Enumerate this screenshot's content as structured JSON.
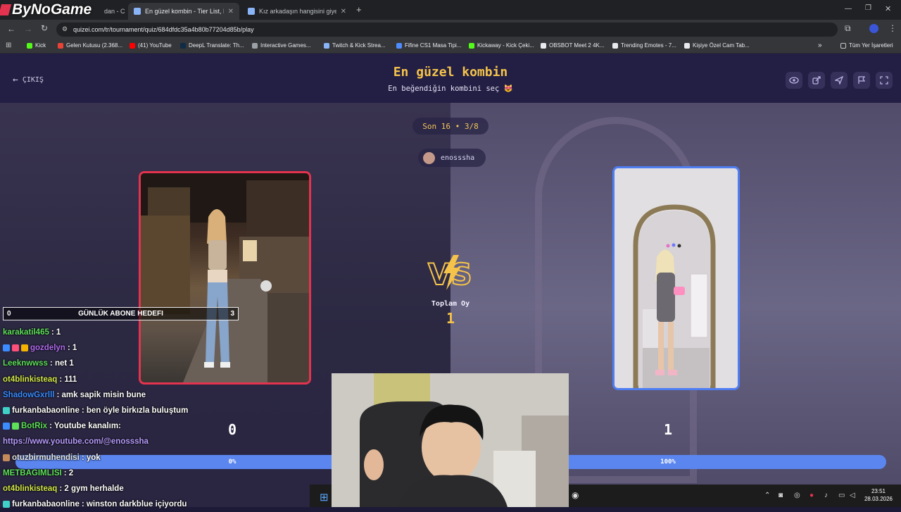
{
  "browser": {
    "tabs": [
      {
        "label": "dan - C"
      },
      {
        "label": "En güzel kombin - Tier List, Kö"
      },
      {
        "label": "Kız arkadaşın hangisini giyebili"
      }
    ],
    "new_tab": "+",
    "url": "quizei.com/tr/tournament/quiz/684dfdc35a4b80b77204d85b/play",
    "bookmarks": [
      {
        "label": "Kick"
      },
      {
        "label": "Gelen Kutusu (2.368..."
      },
      {
        "label": "(41) YouTube"
      },
      {
        "label": "DeepL Translate: Th..."
      },
      {
        "label": "Interactive Games..."
      },
      {
        "label": "Twitch & Kick Strea..."
      },
      {
        "label": "Fifine CS1 Masa Tipi..."
      },
      {
        "label": "Kickaway - Kick Çeki..."
      },
      {
        "label": "OBSBOT Meet 2 4K..."
      },
      {
        "label": "Trending Emotes - 7..."
      },
      {
        "label": "Kişiye Özel Cam Tab..."
      }
    ],
    "all_bookmarks": "Tüm Yer İşaretleri",
    "chevron": "»"
  },
  "overlay": {
    "logo": "ByNoGame",
    "goal": {
      "left": "0",
      "label": "GÜNLÜK ABONE HEDEFI",
      "right": "3"
    },
    "chat": [
      {
        "user": "karakatil465",
        "text": ": 1",
        "color": "#5ee05a",
        "badges": []
      },
      {
        "user": "gozdelyn",
        "text": ": 1",
        "color": "#b06cf0",
        "badges": [
          "#3a8cff",
          "#ff4f7a",
          "#f5b300"
        ]
      },
      {
        "user": "Leeknwwss",
        "text": ": net 1",
        "color": "#5ee05a",
        "badges": []
      },
      {
        "user": "ot4blinkisteaq",
        "text": ": 111",
        "color": "#d4e84a",
        "badges": []
      },
      {
        "user": "ShadowGxrlll",
        "text": ": amk sapik misin bune",
        "color": "#3a8cff",
        "badges": []
      },
      {
        "user": "furkanbabaonline",
        "text": ": ben öyle birkızla buluştum",
        "color": "#ffffff",
        "badges": [
          "#3fd0c8"
        ]
      },
      {
        "user": "BotRix",
        "text": ": Youtube kanalım:",
        "color": "#5ee05a",
        "badges": [
          "#3a8cff",
          "#5ee05a"
        ]
      },
      {
        "user": "",
        "text": "https://www.youtube.com/@enosssha",
        "color": "#b89cff",
        "badges": []
      },
      {
        "user": "otuzbirmuhendisi",
        "text": ": yok",
        "color": "#e6e6e6",
        "badges": [
          "#c58a5a"
        ]
      },
      {
        "user": "METBAGIMLISI",
        "text": ": 2",
        "color": "#5ee05a",
        "badges": []
      },
      {
        "user": "ot4blinkisteaq",
        "text": ": 2 gym herhalde",
        "color": "#d4e84a",
        "badges": []
      },
      {
        "user": "furkanbabaonline",
        "text": ": winston darkblue içiyordu",
        "color": "#ffffff",
        "badges": [
          "#3fd0c8"
        ]
      }
    ]
  },
  "quiz": {
    "exit_label": "ÇIKIŞ",
    "title": "En güzel kombin",
    "subtitle": "En beğendiğin kombini seç 😻",
    "round": "Son 16 • 3/8",
    "creator": "enosssha",
    "vs_text": "VS",
    "total_label": "Toplam Oy",
    "total_value": "1",
    "left": {
      "votes": "0",
      "percent": "0%",
      "progress": 0
    },
    "right": {
      "votes": "1",
      "percent": "100%",
      "progress": 1
    },
    "header_icons": [
      "eye-icon",
      "share-icon",
      "send-icon",
      "flag-icon",
      "fullscreen-icon"
    ]
  },
  "taskbar": {
    "time": "23:51",
    "date": "28.03.2026"
  },
  "colors": {
    "accent_gold": "#f5c34a",
    "left_border": "#e3334f",
    "right_border": "#4f7df2",
    "progress": "#5b86f0"
  }
}
